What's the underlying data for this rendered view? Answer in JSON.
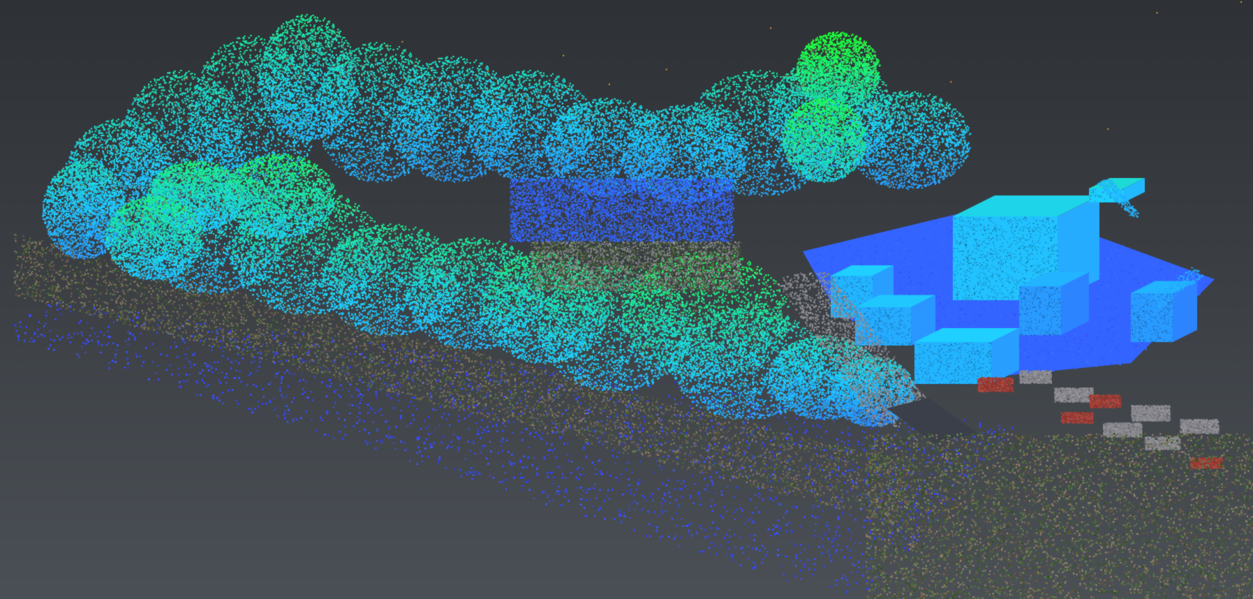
{
  "viewer": {
    "background_top": "#2e3135",
    "background_bottom": "#4b5056"
  },
  "scalar_colormap": {
    "low": "#3c3cff",
    "mid": "#1ecfff",
    "high": "#1eff3c"
  },
  "rgb_palette": {
    "ground": "#7a6a55",
    "vegetation_dark": "#4e6a3a",
    "roof_red": "#a04038",
    "roof_gray": "#8a8a90",
    "asphalt": "#3a3f4a"
  }
}
